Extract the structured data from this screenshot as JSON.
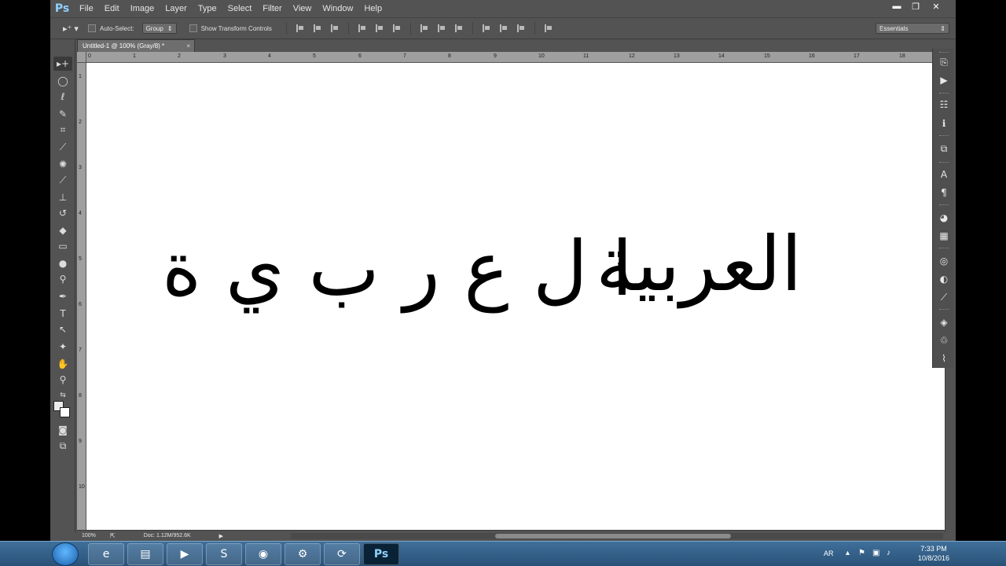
{
  "app": {
    "logo": "Ps",
    "menu": [
      "File",
      "Edit",
      "Image",
      "Layer",
      "Type",
      "Select",
      "Filter",
      "View",
      "Window",
      "Help"
    ],
    "window_controls": {
      "minimize": "▬",
      "restore": "❐",
      "close": "✕"
    }
  },
  "options": {
    "tool_glyph": "▸⁺ ▾",
    "auto_select_label": "Auto-Select:",
    "auto_select_checked": false,
    "auto_select_target": "Group",
    "show_transform_label": "Show Transform Controls",
    "show_transform_checked": false,
    "workspace": "Essentials"
  },
  "document": {
    "tab_title": "Untitled-1 @ 100% (Gray/8) *",
    "tab_close": "×",
    "ruler_h": [
      "0",
      "1",
      "2",
      "3",
      "4",
      "5",
      "6",
      "7",
      "8",
      "9",
      "10",
      "11",
      "12",
      "13",
      "14",
      "15",
      "16",
      "17",
      "18"
    ],
    "ruler_v": [
      "1",
      "2",
      "3",
      "4",
      "5",
      "6",
      "7",
      "8",
      "9",
      "10"
    ],
    "text_left": "ا ل ع ر ب ي ة",
    "text_right": "العربية"
  },
  "status": {
    "zoom": "100%",
    "doc_info": "Doc: 1.12M/952.6K"
  },
  "taskbar": {
    "apps": [
      "e",
      "▤",
      "▶",
      "S",
      "◉",
      "⚙",
      "⟳",
      "Ps"
    ],
    "language": "AR",
    "time": "7:33 PM",
    "date": "10/8/2016"
  }
}
